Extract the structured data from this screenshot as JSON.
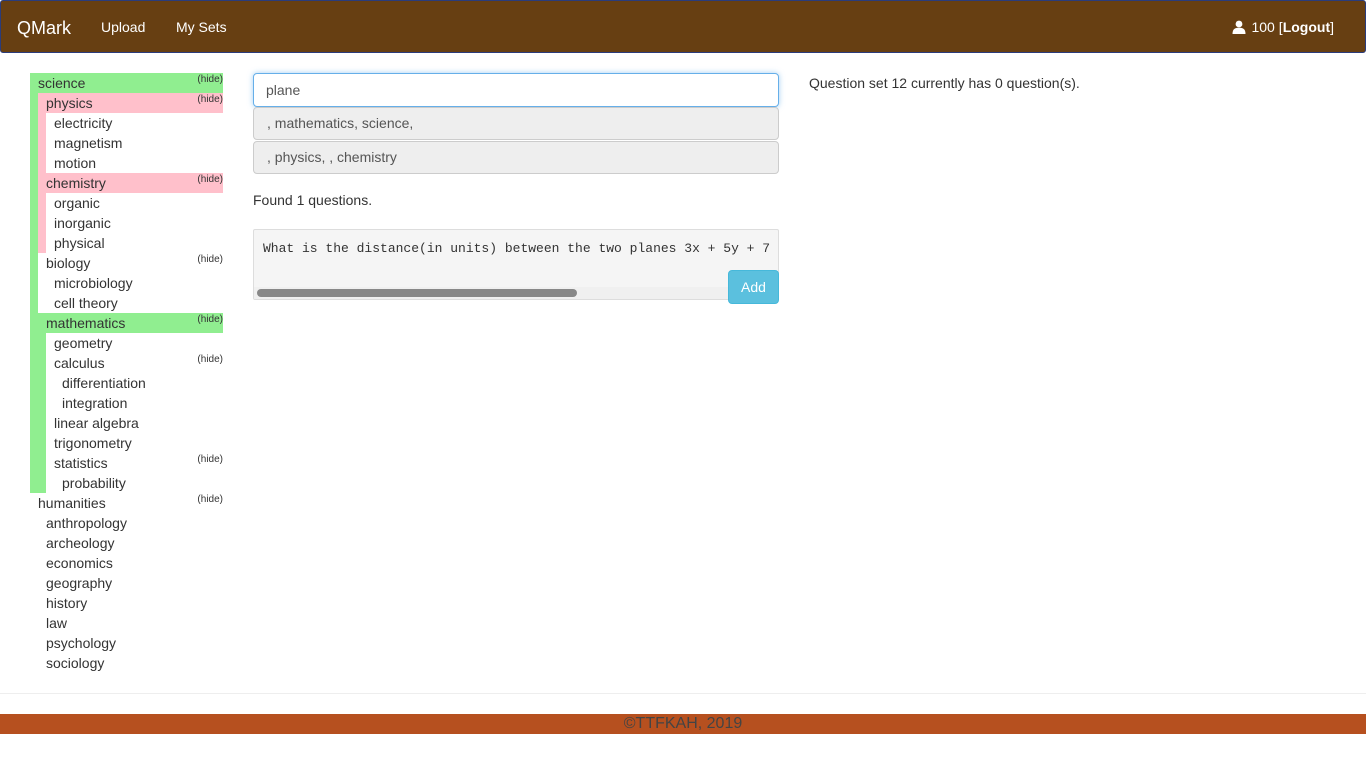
{
  "navbar": {
    "brand": "QMark",
    "links": [
      "Upload",
      "My Sets"
    ],
    "user_score": "100",
    "open_bracket": "[",
    "logout": "Logout",
    "close_bracket": "]"
  },
  "tree": {
    "hide_label": "(hide)",
    "science": {
      "label": "science",
      "physics": {
        "label": "physics",
        "children": [
          "electricity",
          "magnetism",
          "motion"
        ]
      },
      "chemistry": {
        "label": "chemistry",
        "children": [
          "organic",
          "inorganic",
          "physical"
        ]
      },
      "biology": {
        "label": "biology",
        "children": [
          "microbiology",
          "cell theory"
        ]
      },
      "mathematics": {
        "label": "mathematics",
        "geometry": "geometry",
        "calculus": {
          "label": "calculus",
          "children": [
            "differentiation",
            "integration"
          ]
        },
        "linear_algebra": "linear algebra",
        "trigonometry": "trigonometry",
        "statistics": {
          "label": "statistics",
          "children": [
            "probability"
          ]
        }
      }
    },
    "humanities": {
      "label": "humanities",
      "children": [
        "anthropology",
        "archeology",
        "economics",
        "geography",
        "history",
        "law",
        "psychology",
        "sociology"
      ]
    }
  },
  "search": {
    "value": "plane"
  },
  "suggestions": [
    ", mathematics, science,",
    ", physics, , chemistry"
  ],
  "found_text": "Found 1 questions.",
  "question": {
    "text": "What is the distance(in units) between the two planes 3x + 5y + 7",
    "add_label": "Add"
  },
  "status_text": "Question set 12 currently has 0 question(s).",
  "footer": "©TTFKAH, 2019",
  "colors": {
    "navbar": "#673f12",
    "footer": "#b6501f",
    "highlight_green": "#90ee90",
    "highlight_pink": "#ffc0cb",
    "add_button": "#5bc0de"
  }
}
